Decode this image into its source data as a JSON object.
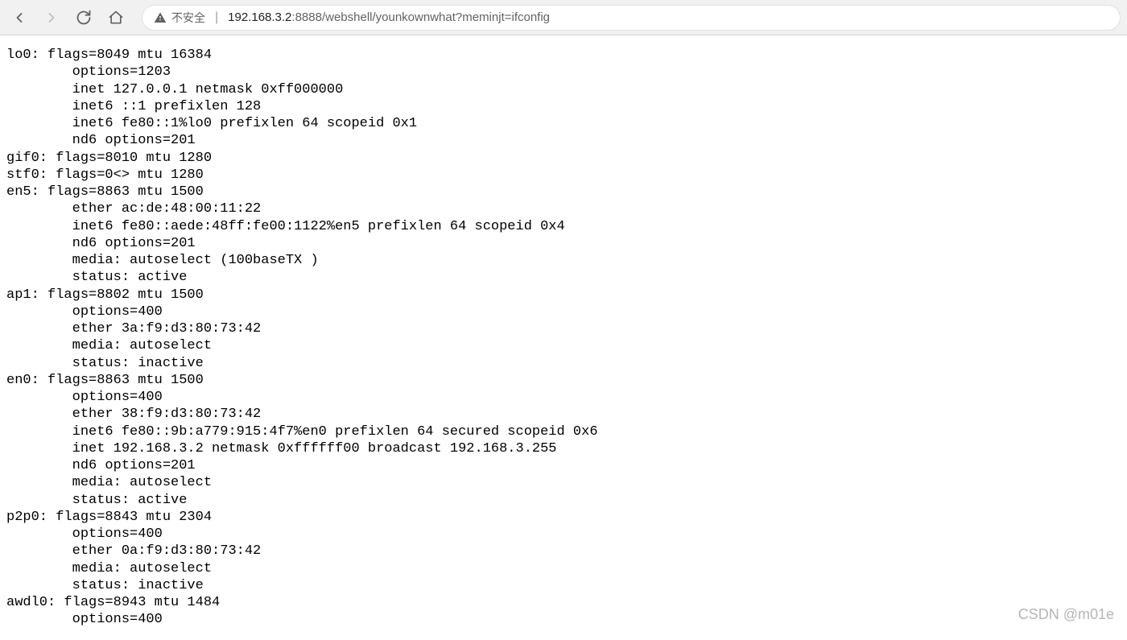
{
  "toolbar": {
    "security_label": "不安全",
    "url_host": "192.168.3.2",
    "url_port": ":8888",
    "url_path": "/webshell/younkownwhat?meminjt=ifconfig"
  },
  "output": {
    "lines": [
      "lo0: flags=8049 mtu 16384",
      "        options=1203",
      "        inet 127.0.0.1 netmask 0xff000000",
      "        inet6 ::1 prefixlen 128",
      "        inet6 fe80::1%lo0 prefixlen 64 scopeid 0x1",
      "        nd6 options=201",
      "gif0: flags=8010 mtu 1280",
      "stf0: flags=0<> mtu 1280",
      "en5: flags=8863 mtu 1500",
      "        ether ac:de:48:00:11:22",
      "        inet6 fe80::aede:48ff:fe00:1122%en5 prefixlen 64 scopeid 0x4",
      "        nd6 options=201",
      "        media: autoselect (100baseTX )",
      "        status: active",
      "ap1: flags=8802 mtu 1500",
      "        options=400",
      "        ether 3a:f9:d3:80:73:42",
      "        media: autoselect",
      "        status: inactive",
      "en0: flags=8863 mtu 1500",
      "        options=400",
      "        ether 38:f9:d3:80:73:42",
      "        inet6 fe80::9b:a779:915:4f7%en0 prefixlen 64 secured scopeid 0x6",
      "        inet 192.168.3.2 netmask 0xffffff00 broadcast 192.168.3.255",
      "        nd6 options=201",
      "        media: autoselect",
      "        status: active",
      "p2p0: flags=8843 mtu 2304",
      "        options=400",
      "        ether 0a:f9:d3:80:73:42",
      "        media: autoselect",
      "        status: inactive",
      "awdl0: flags=8943 mtu 1484",
      "        options=400"
    ]
  },
  "watermark": "CSDN @m01e"
}
